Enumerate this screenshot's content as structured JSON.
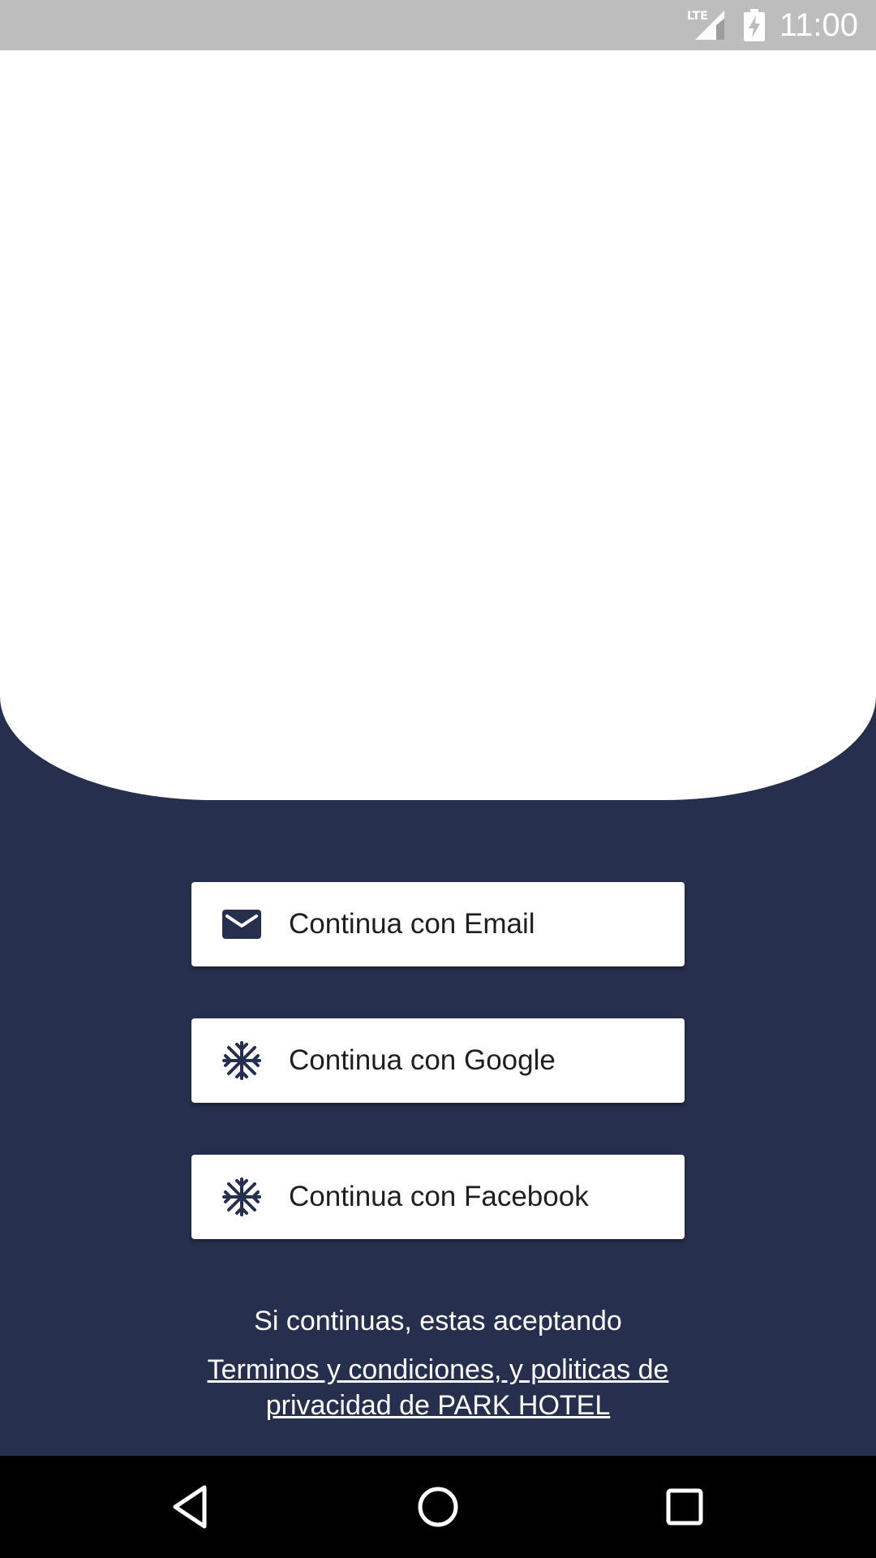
{
  "status_bar": {
    "time": "11:00",
    "network_label": "LTE",
    "icons": [
      "lte-signal-icon",
      "battery-charging-icon"
    ]
  },
  "colors": {
    "background": "#262f4e",
    "button_bg": "#ffffff",
    "icon_color": "#262f4e",
    "text_light": "#ffffff"
  },
  "login": {
    "email_label": "Continua con Email",
    "google_label": "Continua con Google",
    "facebook_label": "Continua con Facebook",
    "email_icon": "mail-icon",
    "google_icon": "snowflake-icon",
    "facebook_icon": "snowflake-icon"
  },
  "terms": {
    "intro": "Si continuas, estas aceptando",
    "link_line1": "Terminos y condiciones, y politicas de",
    "link_line2": " privacidad de PARK HOTEL"
  },
  "nav_bar": {
    "icons": [
      "back-triangle-icon",
      "home-circle-icon",
      "recents-square-icon"
    ]
  }
}
